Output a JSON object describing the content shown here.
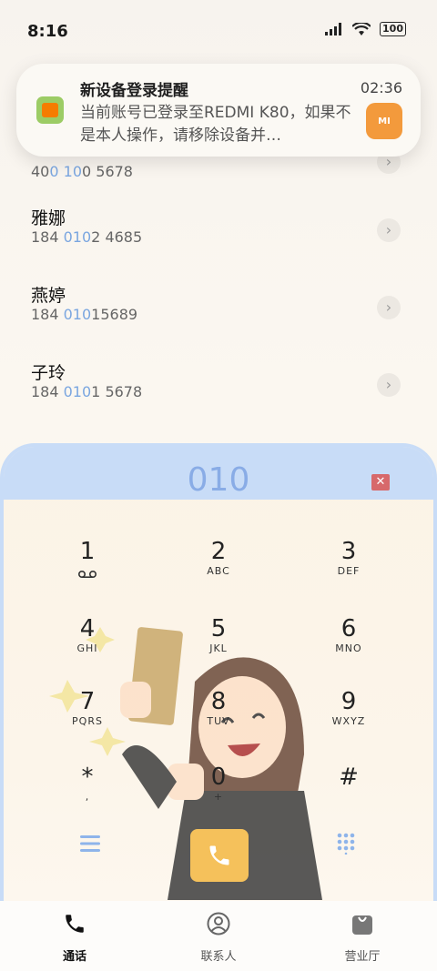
{
  "status_bar": {
    "time": "8:16",
    "battery": "100"
  },
  "notification": {
    "title": "新设备登录提醒",
    "body": "当前账号已登录至REDMI K80，如果不是本人操作，请移除设备并…",
    "time": "02:36",
    "badge": "MI"
  },
  "contacts": [
    {
      "name": "",
      "num_pre": "40",
      "num_hl1": "0",
      "num_mid": " ",
      "num_hl2": "10",
      "num_post": "0 5678"
    },
    {
      "name": "雅娜",
      "num_pre": "184 ",
      "num_hl1": "010",
      "num_mid": "",
      "num_hl2": "",
      "num_post": "2 4685"
    },
    {
      "name": "燕婷",
      "num_pre": "184 ",
      "num_hl1": "010",
      "num_mid": "",
      "num_hl2": "",
      "num_post": "15689"
    },
    {
      "name": "子玲",
      "num_pre": "184 ",
      "num_hl1": "010",
      "num_mid": "",
      "num_hl2": "",
      "num_post": "1 5678"
    }
  ],
  "dialpad": {
    "input": "010",
    "keys": [
      {
        "digit": "1",
        "sub": ""
      },
      {
        "digit": "2",
        "sub": "ABC"
      },
      {
        "digit": "3",
        "sub": "DEF"
      },
      {
        "digit": "4",
        "sub": "GHI"
      },
      {
        "digit": "5",
        "sub": "JKL"
      },
      {
        "digit": "6",
        "sub": "MNO"
      },
      {
        "digit": "7",
        "sub": "PQRS"
      },
      {
        "digit": "8",
        "sub": "TUV"
      },
      {
        "digit": "9",
        "sub": "WXYZ"
      },
      {
        "digit": "*",
        "sub": ","
      },
      {
        "digit": "0",
        "sub": "+"
      },
      {
        "digit": "#",
        "sub": ""
      }
    ]
  },
  "nav": {
    "items": [
      {
        "label": "通话",
        "icon": "phone-icon"
      },
      {
        "label": "联系人",
        "icon": "contacts-icon"
      },
      {
        "label": "营业厅",
        "icon": "store-icon"
      }
    ]
  },
  "colors": {
    "accent": "#89ace6",
    "highlight": "#7aa6e0",
    "call": "#f5c15b",
    "delete": "#d7696b"
  }
}
